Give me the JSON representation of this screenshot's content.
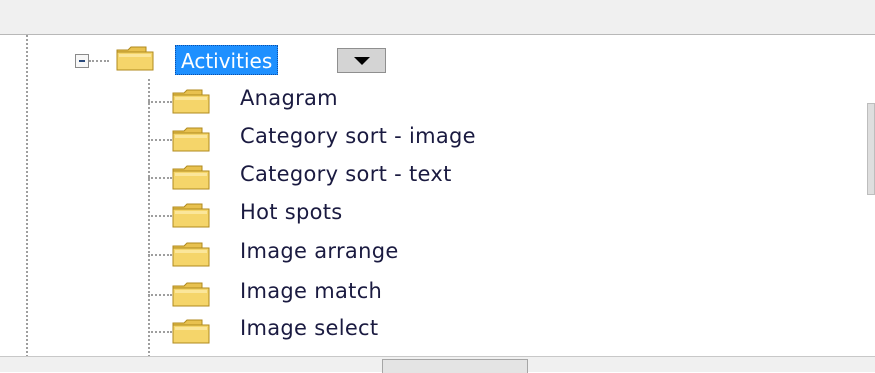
{
  "tree": {
    "root": {
      "label": "Activities",
      "expanded": true,
      "selected": true,
      "icon": "folder-icon",
      "toggle_icon": "collapse-minus-icon",
      "dropdown_icon": "dropdown-arrow-icon"
    },
    "children": [
      {
        "label": "Anagram",
        "icon": "folder-icon"
      },
      {
        "label": "Category sort - image",
        "icon": "folder-icon"
      },
      {
        "label": "Category sort - text",
        "icon": "folder-icon"
      },
      {
        "label": "Hot spots",
        "icon": "folder-icon"
      },
      {
        "label": "Image arrange",
        "icon": "folder-icon"
      },
      {
        "label": "Image match",
        "icon": "folder-icon"
      },
      {
        "label": "Image select",
        "icon": "folder-icon"
      }
    ]
  },
  "colors": {
    "selection": "#1e90ff",
    "label_text": "#1a1a40",
    "folder": "#f5d56a",
    "guide_lines": "#9e9e9e"
  }
}
